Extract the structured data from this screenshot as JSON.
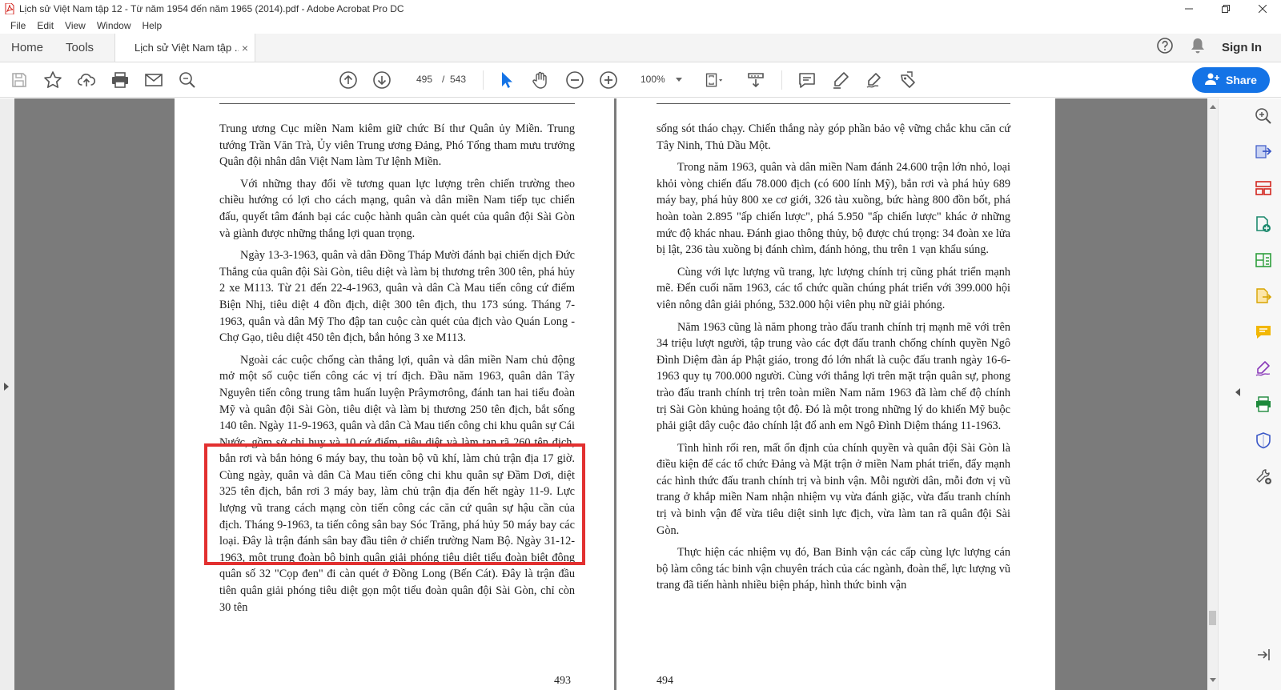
{
  "window": {
    "title": "Lịch sử Việt Nam tập 12 - Từ năm 1954 đến năm 1965 (2014).pdf - Adobe Acrobat Pro DC"
  },
  "menu": [
    "File",
    "Edit",
    "View",
    "Window",
    "Help"
  ],
  "tabs": {
    "home": "Home",
    "tools": "Tools",
    "document": "Lịch sử Việt Nam tập ...",
    "close": "×",
    "sign_in": "Sign In"
  },
  "toolbar": {
    "current_page": "495",
    "page_separator": "/",
    "total_pages": "543",
    "zoom": "100%",
    "share_label": "Share"
  },
  "colors": {
    "accent": "#1473e6",
    "highlight_box": "#e23030",
    "viewer_background": "#7b7b7b"
  },
  "icons": {
    "toolbar": [
      "save-icon",
      "bookmark-star-icon",
      "upload-cloud-icon",
      "print-icon",
      "email-icon",
      "zoom-search-icon",
      "prev-page-icon",
      "next-page-icon",
      "select-cursor-icon",
      "hand-tool-icon",
      "zoom-out-icon",
      "zoom-in-icon",
      "page-fit-icon",
      "scroll-mode-icon",
      "comment-icon",
      "highlight-pen-icon",
      "sign-icon",
      "stamp-icon"
    ],
    "right_panel": [
      "search-zoom-icon",
      "export-pdf-icon",
      "organize-pages-icon",
      "create-pdf-icon",
      "edit-pdf-icon",
      "export-file-icon",
      "comment-tool-icon",
      "fill-sign-icon",
      "print-production-icon",
      "protect-shield-icon",
      "more-tools-icon",
      "collapse-panel-icon"
    ]
  },
  "pages": {
    "left": {
      "number": "493",
      "paragraphs": [
        "Trung ương Cục miền Nam kiêm giữ chức Bí thư Quân ủy Miền. Trung tướng Trần Văn Trà, Ủy viên Trung ương Đảng, Phó Tổng tham mưu trưởng Quân đội nhân dân Việt Nam làm Tư lệnh Miền.",
        "Với những thay đổi về tương quan lực lượng trên chiến trường theo chiều hướng có lợi cho cách mạng, quân và dân miền Nam tiếp tục chiến đấu, quyết tâm đánh bại các cuộc hành quân càn quét của quân đội Sài Gòn và giành được những thắng lợi quan trọng.",
        "Ngày 13-3-1963, quân và dân Đồng Tháp Mười đánh bại chiến dịch Đức Thắng của quân đội Sài Gòn, tiêu diệt và làm bị thương trên 300 tên, phá hủy 2 xe M113. Từ 21 đến 22-4-1963, quân và dân Cà Mau tiến công cứ điểm Biện Nhị, tiêu diệt 4 đồn địch, diệt 300 tên địch, thu 173 súng. Tháng 7-1963, quân và dân Mỹ Tho đập tan cuộc càn quét của địch vào Quán Long - Chợ Gạo, tiêu diệt 450 tên địch, bắn hỏng 3 xe M113.",
        "Ngoài các cuộc chống càn thắng lợi, quân và dân miền Nam chủ động mở một số cuộc tiến công các vị trí địch. Đầu năm 1963, quân dân Tây Nguyên tiến công trung tâm huấn luyện Prâymơrông, đánh tan hai tiểu đoàn Mỹ và quân đội Sài Gòn, tiêu diệt và làm bị thương 250 tên địch, bắt sống 140 tên. Ngày 11-9-1963, quân và dân Cà Mau tiến công chi khu quân sự Cái Nước, gồm sở chỉ huy và 10 cứ điểm, tiêu diệt và làm tan rã 260 tên địch, bắn rơi và bắn hỏng 6 máy bay, thu toàn bộ vũ khí, làm chủ trận địa 17 giờ. Cùng ngày, quân và dân Cà Mau tiến công chi khu quân sự Đầm Dơi, diệt 325 tên địch, bắn rơi 3 máy bay, làm chủ trận địa đến hết ngày 11-9. Lực lượng vũ trang cách mạng còn tiến công các căn cứ quân sự hậu cần của địch. Tháng 9-1963, ta tiến công sân bay Sóc Trăng, phá hủy 50 máy bay các loại. Đây là trận đánh sân bay đầu tiên ở chiến trường Nam Bộ. Ngày 31-12-1963, một trung đoàn bộ binh quân giải phóng tiêu diệt tiểu đoàn biệt động quân số 32 \"Cọp đen\" đi càn quét ở Đồng Long (Bến Cát). Đây là trận đầu tiên quân giải phóng tiêu diệt gọn một tiểu đoàn quân đội Sài Gòn, chỉ còn 30 tên"
      ]
    },
    "right": {
      "number": "494",
      "paragraphs": [
        "sống sót tháo chạy. Chiến thắng này góp phần bảo vệ vững chắc khu căn cứ Tây Ninh, Thủ Dầu Một.",
        "Trong năm 1963, quân và dân miền Nam đánh 24.600 trận lớn nhỏ, loại khỏi vòng chiến đấu 78.000 địch (có 600 lính Mỹ), bắn rơi và phá hủy 689 máy bay, phá hủy 800 xe cơ giới, 326 tàu xuồng, bức hàng 800 đồn bốt, phá hoàn toàn 2.895 \"ấp chiến lược\", phá 5.950 \"ấp chiến lược\" khác ở những mức độ khác nhau. Đánh giao thông thủy, bộ được chú trọng: 34 đoàn xe lửa bị lật, 236 tàu xuồng bị đánh chìm, đánh hỏng, thu trên 1 vạn khẩu súng.",
        "Cùng với lực lượng vũ trang, lực lượng chính trị cũng phát triển mạnh mẽ. Đến cuối năm 1963, các tổ chức quần chúng phát triển với 399.000 hội viên nông dân giải phóng, 532.000 hội viên phụ nữ giải phóng.",
        "Năm 1963 cũng là năm phong trào đấu tranh chính trị mạnh mẽ với trên 34 triệu lượt người, tập trung vào các đợt đấu tranh chống chính quyền Ngô Đình Diệm đàn áp Phật giáo, trong đó lớn nhất là cuộc đấu tranh ngày 16-6-1963 quy tụ 700.000 người. Cùng với thắng lợi trên mặt trận quân sự, phong trào đấu tranh chính trị trên toàn miền Nam năm 1963 đã làm chế độ chính trị Sài Gòn khủng hoảng tột độ. Đó là một trong những lý do khiến Mỹ buộc phải giật dây cuộc đảo chính lật đổ anh em Ngô Đình Diệm tháng 11-1963.",
        "Tình hình rối ren, mất ổn định của chính quyền và quân đội Sài Gòn là điều kiện để các tổ chức Đảng và Mặt trận ở miền Nam phát triển, đẩy mạnh các hình thức đấu tranh chính trị và binh vận. Mỗi người dân, mỗi đơn vị vũ trang ở khắp miền Nam nhận nhiệm vụ vừa đánh giặc, vừa đấu tranh chính trị và binh vận để vừa tiêu diệt sinh lực địch, vừa làm tan rã quân đội Sài Gòn.",
        "Thực hiện các nhiệm vụ đó, Ban Binh vận các cấp cùng lực lượng cán bộ làm công tác binh vận chuyên trách của các ngành, đoàn thể, lực lượng vũ trang đã tiến hành nhiều biện pháp, hình thức binh vận"
      ]
    }
  }
}
